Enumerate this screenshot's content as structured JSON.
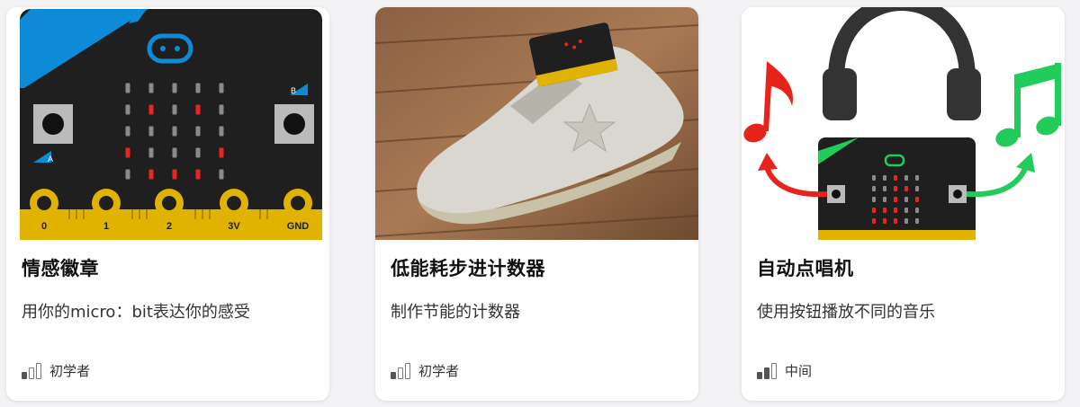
{
  "cards": [
    {
      "title": "情感徽章",
      "description": "用你的micro：bit表达你的感受",
      "level": "初学者",
      "level_value": 1,
      "image": "microbit-board-heart",
      "pin_labels": [
        "0",
        "1",
        "2",
        "3V",
        "GND"
      ],
      "button_labels": [
        "A",
        "B"
      ]
    },
    {
      "title": "低能耗步进计数器",
      "description": "制作节能的计数器",
      "level": "初学者",
      "level_value": 1,
      "image": "shoe-with-microbit"
    },
    {
      "title": "自动点唱机",
      "description": "使用按钮播放不同的音乐",
      "level": "中间",
      "level_value": 2,
      "image": "headphones-microbit-music-notes"
    }
  ],
  "colors": {
    "board": "#1f1f1f",
    "accent_blue": "#0e8bd6",
    "pin_gold": "#e0b300",
    "led_red": "#e8261f",
    "note_red": "#e8231a",
    "note_green": "#22cc5b"
  }
}
